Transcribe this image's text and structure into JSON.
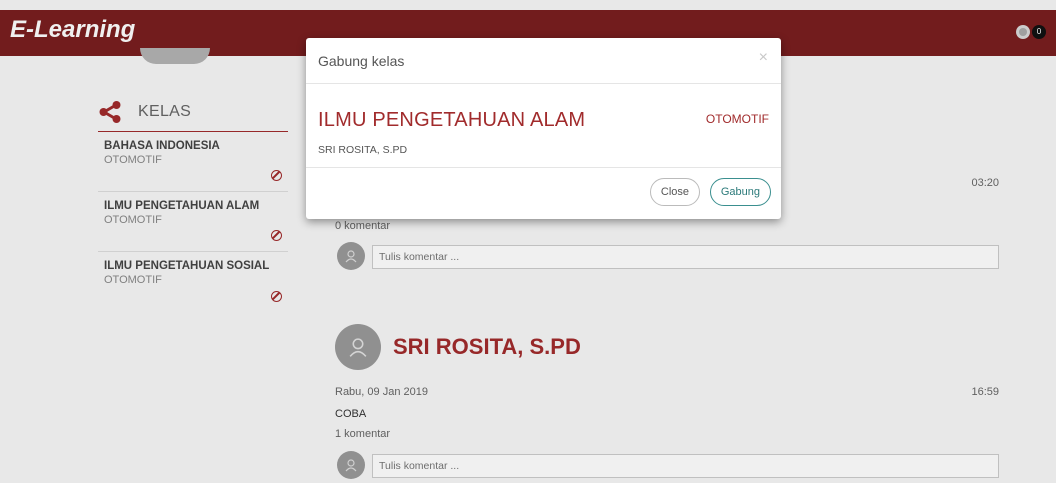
{
  "header": {
    "brand": "E-Learning",
    "notification_count": "0",
    "icons": [
      "globe-icon",
      "notification-badge"
    ]
  },
  "sidebar": {
    "title": "KELAS",
    "title_icon": "share-icon",
    "courses": [
      {
        "name": "BAHASA INDONESIA",
        "dept": "OTOMOTIF",
        "icon": "ban-icon"
      },
      {
        "name": "ILMU PENGETAHUAN ALAM",
        "dept": "OTOMOTIF",
        "icon": "ban-icon"
      },
      {
        "name": "ILMU PENGETAHUAN SOSIAL",
        "dept": "OTOMOTIF",
        "icon": "ban-icon"
      }
    ]
  },
  "feed": {
    "post1": {
      "time": "03:20",
      "comments": "0 komentar",
      "comment_placeholder": "Tulis komentar ..."
    },
    "post2": {
      "author": "SRI ROSITA, S.PD",
      "date": "Rabu, 09 Jan 2019",
      "time": "16:59",
      "text": "COBA",
      "comments": "1 komentar",
      "comment_placeholder": "Tulis komentar ..."
    }
  },
  "modal": {
    "title": "Gabung kelas",
    "close_symbol": "×",
    "course_name": "ILMU PENGETAHUAN ALAM",
    "department": "OTOMOTIF",
    "teacher": "SRI ROSITA, S.PD",
    "close_button": "Close",
    "join_button": "Gabung"
  },
  "colors": {
    "navbar": "#7a1e1f",
    "accent": "#a12b2c",
    "join_button": "#3a8f8f"
  }
}
